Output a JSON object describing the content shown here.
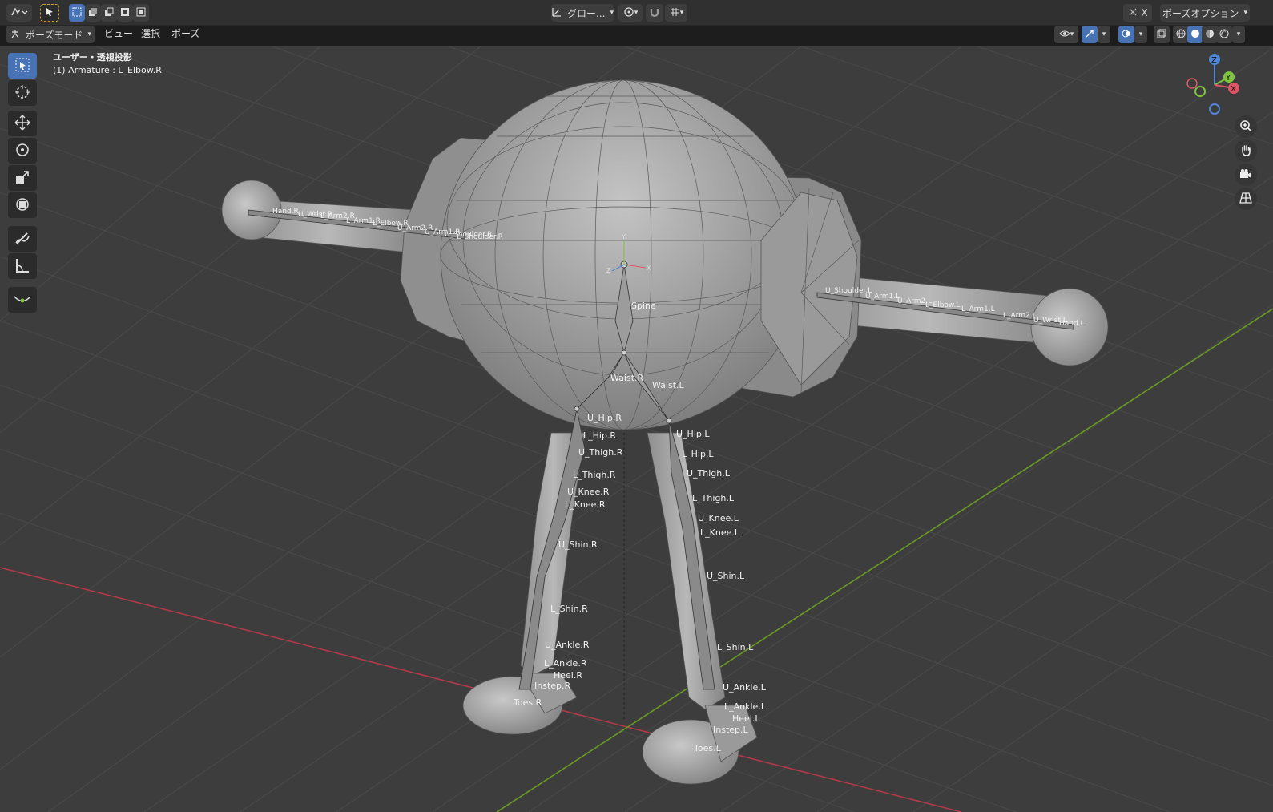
{
  "header": {
    "orientation_dropdown": "グロー...",
    "pose_options": "ポーズオプション",
    "x_label": "X"
  },
  "menubar": {
    "mode": "ポーズモード",
    "items": [
      "ビュー",
      "選択",
      "ポーズ"
    ]
  },
  "viewport": {
    "view_name": "ユーザー・透視投影",
    "object_info": "(1) Armature : L_Elbow.R"
  },
  "gizmo": {
    "z": "Z",
    "y": "Y",
    "x": "X"
  },
  "bones": {
    "spine": "Spine",
    "waist_r": "Waist.R",
    "waist_l": "Waist.L",
    "u_hip_r": "U_Hip.R",
    "l_hip_r": "L_Hip.R",
    "u_thigh_r": "U_Thigh.R",
    "l_thigh_r": "L_Thigh.R",
    "u_knee_r": "U_Knee.R",
    "l_knee_r": "L_Knee.R",
    "u_shin_r": "U_Shin.R",
    "l_shin_r": "L_Shin.R",
    "u_ankle_r": "U_Ankle.R",
    "l_ankle_r": "L_Ankle.R",
    "heel_r": "Heel.R",
    "instep_r": "Instep.R",
    "toes_r": "Toes.R",
    "u_hip_l": "U_Hip.L",
    "l_hip_l": "L_Hip.L",
    "u_thigh_l": "U_Thigh.L",
    "l_thigh_l": "L_Thigh.L",
    "u_knee_l": "U_Knee.L",
    "l_knee_l": "L_Knee.L",
    "u_shin_l": "U_Shin.L",
    "l_shin_l": "L_Shin.L",
    "u_ankle_l": "U_Ankle.L",
    "l_ankle_l": "L_Ankle.L",
    "heel_l": "Heel.L",
    "instep_l": "Instep.L",
    "toes_l": "Toes.L",
    "hand_r": "Hand.R",
    "u_wrist_r": "U_Wrist.R",
    "l_arm2_r": "L_Arm2.R",
    "l_arm1_r": "L_Arm1.R",
    "l_elbow_r": "L_Elbow.R",
    "u_arm2_r": "U_Arm2.R",
    "u_arm1_r": "U_Arm1.R",
    "u_shoulder_r": "U_Shoulder.R",
    "l_shoulder_r": "L_Shoulder.R",
    "u_shoulder_l": "U_Shoulder.L",
    "u_arm1_l": "U_Arm1.L",
    "u_arm2_l": "U_Arm2.L",
    "l_elbow_l": "L_Elbow.L",
    "l_arm1_l": "L_Arm1.L",
    "l_arm2_l": "L_Arm2.L",
    "u_wrist_l": "U_Wrist.L",
    "hand_l": "Hand.L"
  },
  "colors": {
    "header_bg": "#303030",
    "viewport_bg": "#3d3d3d",
    "grid": "#4a4a4a",
    "x_axis": "#b03a48",
    "y_axis": "#6a9a24",
    "mesh": "#a8a8a8",
    "accent": "#4772b3"
  }
}
